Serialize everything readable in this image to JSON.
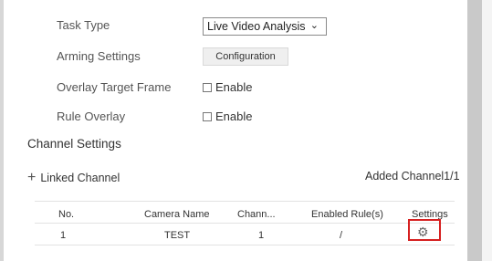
{
  "form": {
    "task_type_label": "Task Type",
    "task_type_value": "Live Video Analysis",
    "arming_settings_label": "Arming Settings",
    "configuration_button": "Configuration",
    "overlay_target_frame_label": "Overlay Target Frame",
    "overlay_target_frame_option": "Enable",
    "overlay_target_frame_checked": false,
    "rule_overlay_label": "Rule Overlay",
    "rule_overlay_option": "Enable",
    "rule_overlay_checked": false
  },
  "channel": {
    "section_title": "Channel Settings",
    "linked_channel_label": "Linked Channel",
    "added_channel_text": "Added Channel1/1"
  },
  "table": {
    "headers": [
      "No.",
      "Camera Name",
      "Chann...",
      "Enabled Rule(s)",
      "Settings"
    ],
    "rows": [
      {
        "no": "1",
        "camera_name": "TEST",
        "channel": "1",
        "enabled_rules": "/",
        "settings_icon": "gear-icon"
      }
    ]
  },
  "colors": {
    "highlight": "#d62020"
  }
}
